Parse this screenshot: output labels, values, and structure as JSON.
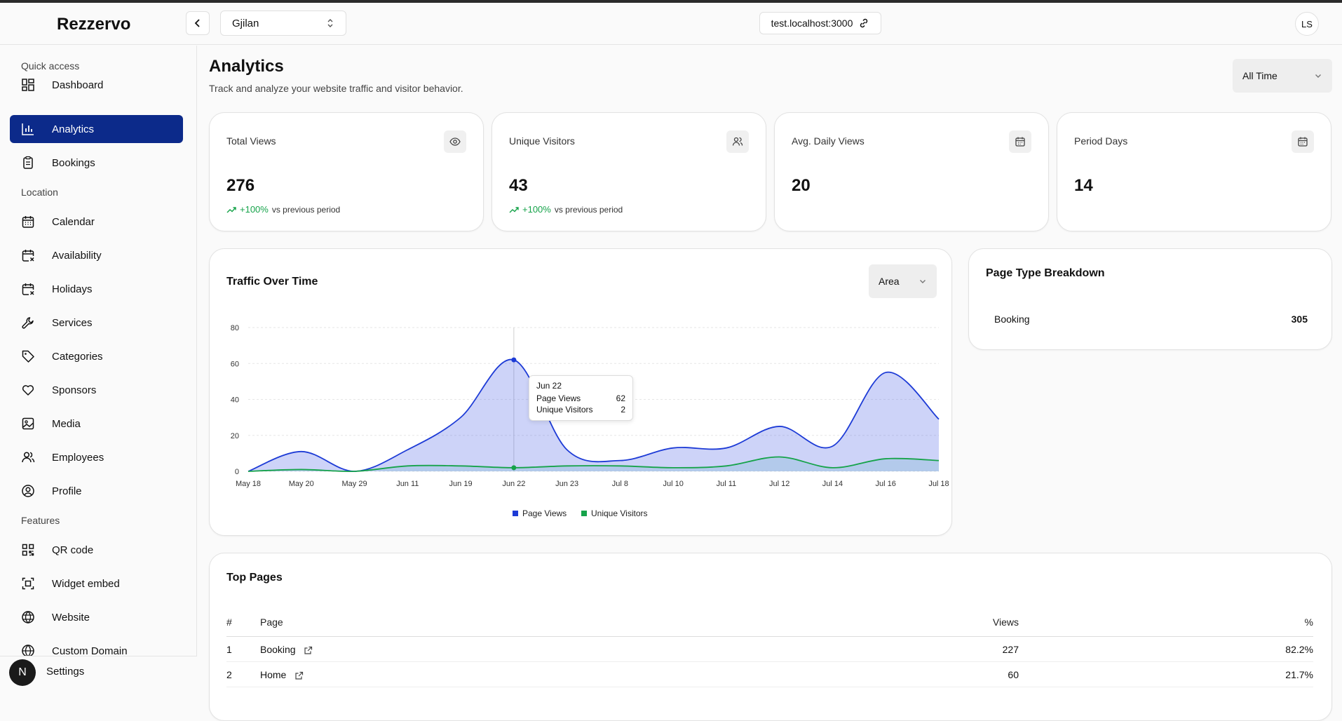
{
  "header": {
    "brand": "Rezzervo",
    "location": "Gjilan",
    "url": "test.localhost:3000",
    "avatar": "LS"
  },
  "sidebar": {
    "sections": [
      {
        "label": "Quick access"
      },
      {
        "label": "Location"
      },
      {
        "label": "Features"
      }
    ],
    "items": [
      {
        "label": "Dashboard",
        "icon": "dashboard-icon"
      },
      {
        "label": "Analytics",
        "icon": "analytics-icon",
        "active": true
      },
      {
        "label": "Bookings",
        "icon": "clipboard-icon"
      },
      {
        "label": "Calendar",
        "icon": "calendar-icon"
      },
      {
        "label": "Availability",
        "icon": "calendar-x-icon"
      },
      {
        "label": "Holidays",
        "icon": "calendar-x-icon"
      },
      {
        "label": "Services",
        "icon": "wrench-icon"
      },
      {
        "label": "Categories",
        "icon": "tag-icon"
      },
      {
        "label": "Sponsors",
        "icon": "heart-icon"
      },
      {
        "label": "Media",
        "icon": "image-icon"
      },
      {
        "label": "Employees",
        "icon": "users-icon"
      },
      {
        "label": "Profile",
        "icon": "user-circle-icon"
      },
      {
        "label": "QR code",
        "icon": "qr-code-icon"
      },
      {
        "label": "Widget embed",
        "icon": "widget-icon"
      },
      {
        "label": "Website",
        "icon": "globe-icon"
      },
      {
        "label": "Custom Domain",
        "icon": "globe-icon"
      }
    ],
    "settings": "Settings",
    "badge": "N"
  },
  "page": {
    "title": "Analytics",
    "subtitle": "Track and analyze your website traffic and visitor behavior.",
    "range": "All Time"
  },
  "stats": [
    {
      "label": "Total Views",
      "value": "276",
      "change": "+100%",
      "change_note": "vs previous period",
      "icon": "eye-icon"
    },
    {
      "label": "Unique Visitors",
      "value": "43",
      "change": "+100%",
      "change_note": "vs previous period",
      "icon": "users-icon"
    },
    {
      "label": "Avg. Daily Views",
      "value": "20",
      "icon": "calendar-icon"
    },
    {
      "label": "Period Days",
      "value": "14",
      "icon": "calendar-icon"
    }
  ],
  "traffic": {
    "title": "Traffic Over Time",
    "chart_type": "Area"
  },
  "chart_data": {
    "type": "area",
    "categories": [
      "May 18",
      "May 20",
      "May 29",
      "Jun 11",
      "Jun 19",
      "Jun 22",
      "Jun 23",
      "Jul 8",
      "Jul 10",
      "Jul 11",
      "Jul 12",
      "Jul 14",
      "Jul 16",
      "Jul 18"
    ],
    "series": [
      {
        "name": "Page Views",
        "values": [
          0,
          11,
          0,
          12,
          30,
          62,
          12,
          6,
          13,
          13,
          25,
          14,
          55,
          29
        ],
        "color": "#1d3bd6"
      },
      {
        "name": "Unique Visitors",
        "values": [
          0,
          1,
          0,
          3,
          3,
          2,
          3,
          3,
          2,
          3,
          8,
          2,
          7,
          6
        ],
        "color": "#16a34a"
      }
    ],
    "yticks": [
      0,
      20,
      40,
      60,
      80
    ],
    "ylim": [
      0,
      80
    ],
    "legend": "bottom",
    "grid": true,
    "tooltip": {
      "category": "Jun 22",
      "rows": [
        {
          "label": "Page Views",
          "value": "62"
        },
        {
          "label": "Unique Visitors",
          "value": "2"
        }
      ]
    }
  },
  "breakdown": {
    "title": "Page Type Breakdown",
    "rows": [
      {
        "label": "Booking",
        "value": "305"
      }
    ]
  },
  "top_pages": {
    "title": "Top Pages",
    "columns": [
      "#",
      "Page",
      "Views",
      "%"
    ],
    "rows": [
      {
        "rank": "1",
        "page": "Booking",
        "views": "227",
        "pct": "82.2%"
      },
      {
        "rank": "2",
        "page": "Home",
        "views": "60",
        "pct": "21.7%"
      }
    ]
  }
}
